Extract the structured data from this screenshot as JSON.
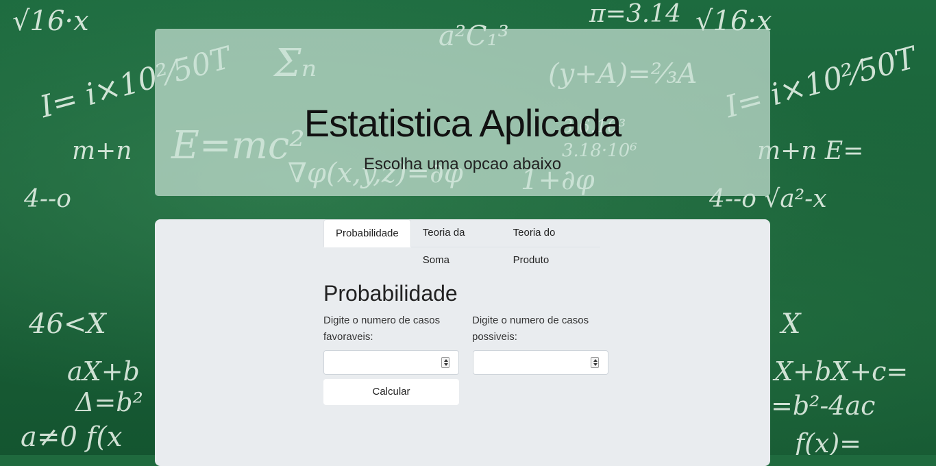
{
  "header": {
    "title": "Estatistica Aplicada",
    "subtitle": "Escolha uma opcao abaixo"
  },
  "tabs": [
    {
      "label": "Probabilidade",
      "active": true
    },
    {
      "label": "Teoria da Soma",
      "active": false
    },
    {
      "label": "Teoria do Produto",
      "active": false
    }
  ],
  "probabilidade": {
    "title": "Probabilidade",
    "favoraveis_label": "Digite o numero de casos favoraveis:",
    "favoraveis_value": "",
    "possiveis_label": "Digite o numero de casos possiveis:",
    "possiveis_value": "",
    "calcular_label": "Calcular"
  },
  "colors": {
    "board": "#1d6b3f",
    "card": "#e9ecef",
    "jumbotron": "#c8e1d4"
  }
}
